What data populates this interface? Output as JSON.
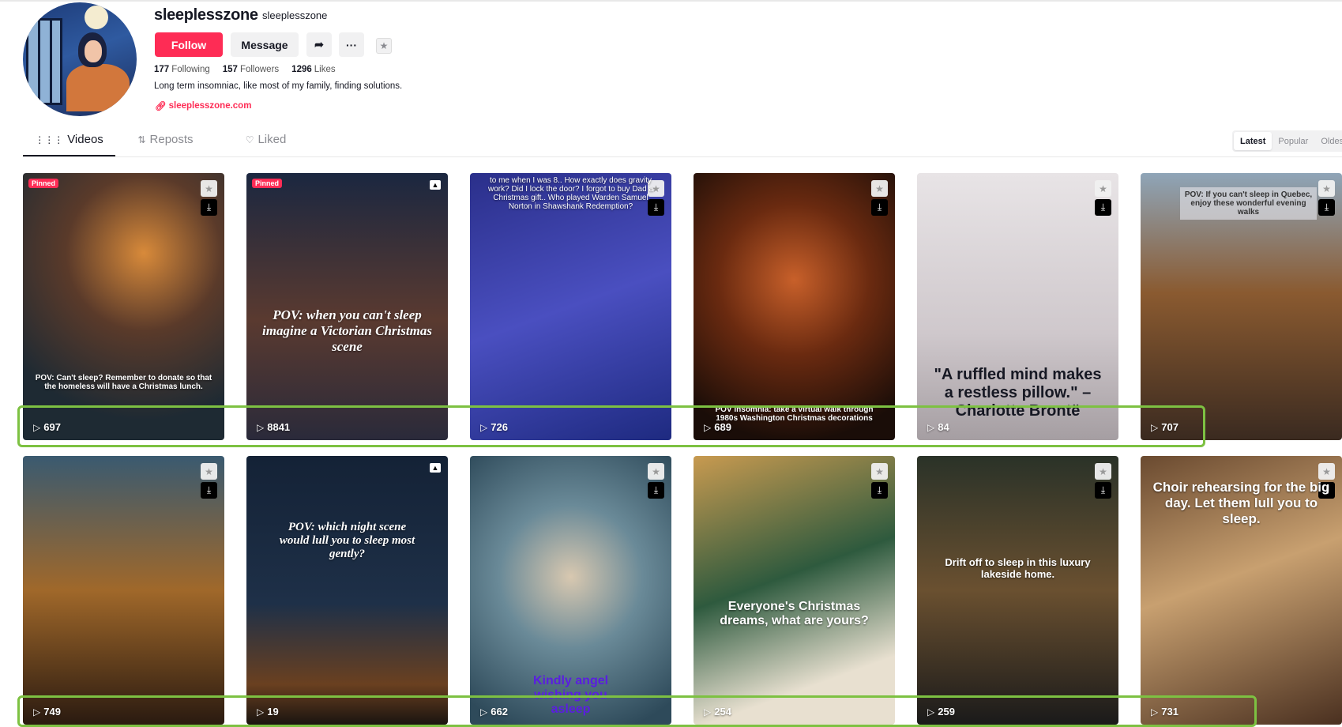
{
  "profile": {
    "display_name": "sleeplesszone",
    "username": "sleeplesszone",
    "follow_label": "Follow",
    "message_label": "Message",
    "following_count": "177",
    "following_label": "Following",
    "followers_count": "157",
    "followers_label": "Followers",
    "likes_count": "1296",
    "likes_label": "Likes",
    "bio": "Long term insomniac, like most of my family, finding solutions.",
    "link": "sleeplesszone.com",
    "accent_color": "#fe2c55"
  },
  "tabs": [
    {
      "label": "Videos",
      "icon": "grid-icon",
      "active": true
    },
    {
      "label": "Reposts",
      "icon": "repost-icon"
    },
    {
      "label": "Liked",
      "icon": "heart-icon"
    }
  ],
  "sort": [
    "Latest",
    "Popular",
    "Oldest"
  ],
  "pinned_label": "Pinned",
  "highlight_color": "#7dc142",
  "videos": [
    {
      "views": "697",
      "pinned": true,
      "caption": "POV: Can't sleep? Remember to donate so that the homeless will have a Christmas lunch."
    },
    {
      "views": "8841",
      "pinned": true,
      "photo": true,
      "caption": "POV: when you can't sleep imagine a Victorian Christmas scene"
    },
    {
      "views": "726",
      "caption": "to me when I was 8.. How exactly does gravity work? Did I lock the door? I forgot to buy Dad a Christmas gift.. Who played Warden Samuel Norton in Shawshank Redemption?"
    },
    {
      "views": "689",
      "caption": "POV Insomnia: take a virtual walk through 1980s Washington Christmas decorations"
    },
    {
      "views": "84",
      "caption": "\"A ruffled mind makes a restless pillow.\" – Charlotte Brontë"
    },
    {
      "views": "707",
      "caption": "POV: If you can't sleep in Quebec, enjoy these wonderful evening walks"
    },
    {
      "views": "749",
      "caption": ""
    },
    {
      "views": "19",
      "photo": true,
      "caption": "POV: which night scene would lull you to sleep most gently?"
    },
    {
      "views": "662",
      "caption": "Kindly angel wishing you asleep"
    },
    {
      "views": "254",
      "caption": "Everyone's Christmas dreams, what are yours?"
    },
    {
      "views": "259",
      "caption": "Drift off to sleep in this luxury lakeside home."
    },
    {
      "views": "731",
      "caption": "Choir rehearsing for the big day. Let them lull you to sleep."
    }
  ]
}
